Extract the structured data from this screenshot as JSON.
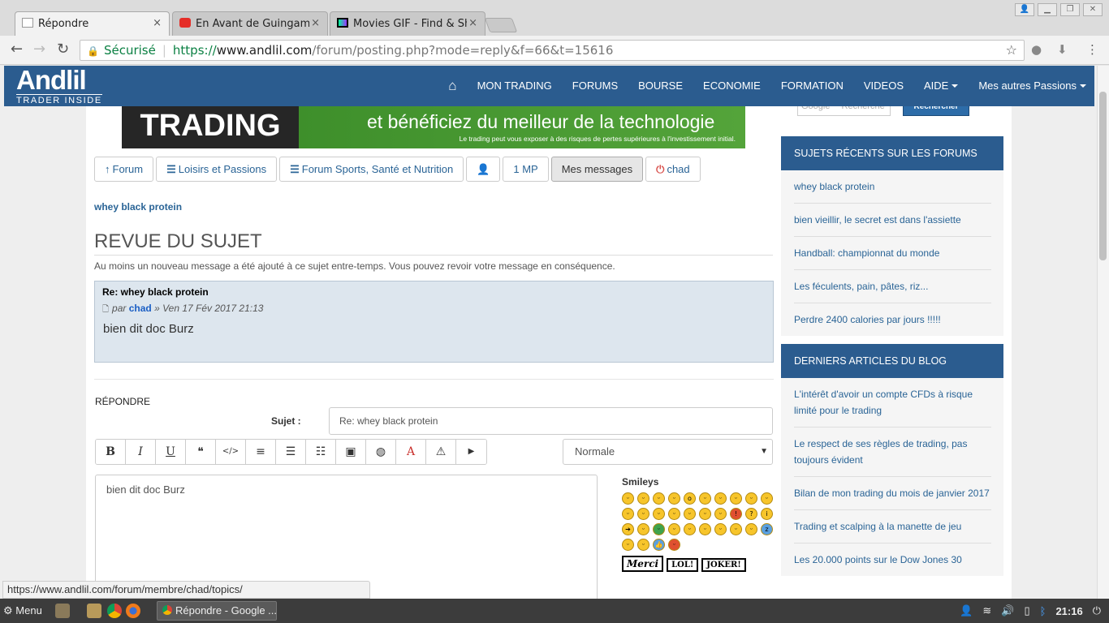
{
  "browser": {
    "tabs": [
      {
        "title": "Répondre",
        "close": "×",
        "active": true
      },
      {
        "title": "En Avant de Guingamp",
        "close": "×",
        "active": false
      },
      {
        "title": "Movies GIF - Find & Share",
        "close": "×",
        "active": false
      }
    ],
    "nav": {
      "back": "←",
      "forward": "→",
      "reload": "↻"
    },
    "address": {
      "secure_label": "Sécurisé",
      "protocol": "https://",
      "host": "www.andlil.com",
      "path": "/forum/posting.php?mode=reply&f=66&t=15616"
    },
    "status_url": "https://www.andlil.com/forum/membre/chad/topics/"
  },
  "site": {
    "logo_main": "Andlil",
    "logo_sub": "TRADER INSIDE",
    "menu": [
      "MON TRADING",
      "FORUMS",
      "BOURSE",
      "ECONOMIE",
      "FORMATION",
      "VIDEOS",
      "AIDE",
      "Mes autres Passions"
    ],
    "home_icon": "⌂"
  },
  "banner": {
    "left_text": "TRADING",
    "headline": "et bénéficiez du meilleur de la technologie",
    "disclaimer": "Le trading peut vous exposer à des risques de pertes supérieures à l'investissement initial."
  },
  "buttons": {
    "forum": "Forum",
    "loisirs": "Loisirs et Passions",
    "sports": "Forum Sports, Santé et Nutrition",
    "mp": "1 MP",
    "messages": "Mes messages",
    "chad": "chad"
  },
  "topic": {
    "link": "whey black protein",
    "revue_title": "REVUE DU SUJET",
    "notice": "Au moins un nouveau message a été ajouté à ce sujet entre-temps. Vous pouvez revoir votre message en conséquence.",
    "post": {
      "title": "Re: whey black protein",
      "by": "par",
      "author": "chad",
      "date": "» Ven 17 Fév 2017 21:13",
      "body": "bien dit doc Burz"
    }
  },
  "reply": {
    "section_label": "RÉPONDRE",
    "subject_label": "Sujet :",
    "subject_value": "Re: whey black protein",
    "size_selected": "Normale",
    "body": "bien dit doc Burz",
    "smileys_title": "Smileys",
    "toolbar": [
      "B",
      "I",
      "U",
      "❝",
      "</>",
      "≡",
      "☰",
      "☷",
      "▣",
      "◍",
      "A",
      "⚠",
      "▶"
    ],
    "signs": [
      "Merci",
      "LOL!",
      "JOKER!"
    ]
  },
  "sidebar": {
    "search_placeholder": "Google™ Recherche",
    "search_button": "Rechercher",
    "recent_title": "SUJETS RÉCENTS SUR LES FORUMS",
    "recent": [
      "whey black protein",
      "bien vieillir, le secret est dans l'assiette",
      "Handball: championnat du monde",
      "Les féculents, pain, pâtes, riz...",
      "Perdre 2400 calories par jours !!!!!"
    ],
    "blog_title": "DERNIERS ARTICLES DU BLOG",
    "blog": [
      "L'intérêt d'avoir un compte CFDs à risque limité pour le trading",
      "Le respect de ses règles de trading, pas toujours évident",
      "Bilan de mon trading du mois de janvier 2017",
      "Trading et scalping à la manette de jeu",
      "Les 20.000 points sur le Dow Jones 30"
    ]
  },
  "taskbar": {
    "menu": "Menu",
    "task": "Répondre - Google ...",
    "clock": "21:16"
  }
}
